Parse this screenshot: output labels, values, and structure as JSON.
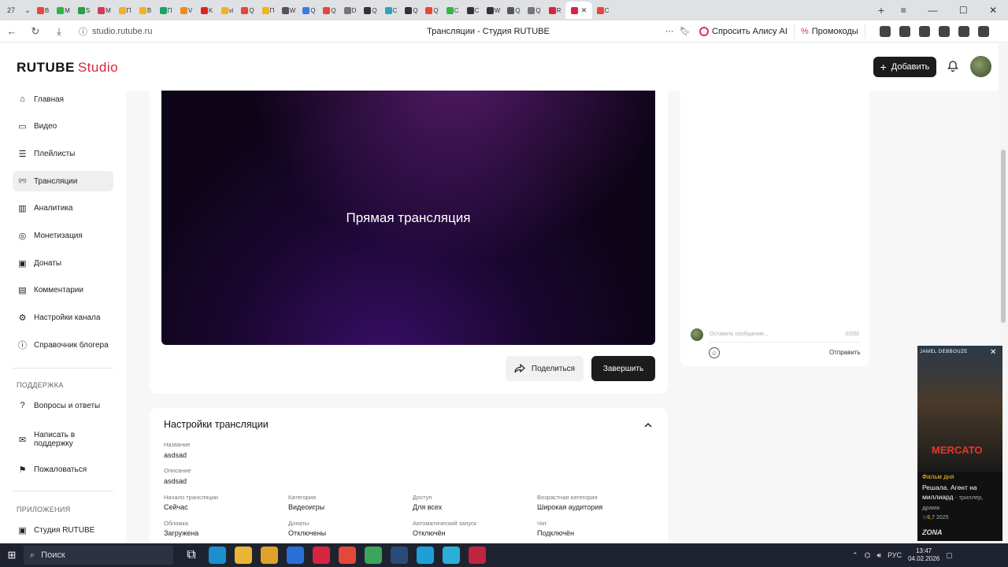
{
  "browser": {
    "tab_counter": "27",
    "tabs": [
      {
        "letter": "В",
        "color": "#e5483b"
      },
      {
        "letter": "М",
        "color": "#2db64a"
      },
      {
        "letter": "S",
        "color": "#25a244"
      },
      {
        "letter": "М",
        "color": "#d63b5a"
      },
      {
        "letter": "П",
        "color": "#f2b31b"
      },
      {
        "letter": "В",
        "color": "#f2b31b"
      },
      {
        "letter": "П",
        "color": "#1da462"
      },
      {
        "letter": "V",
        "color": "#f28b1b"
      },
      {
        "letter": "K",
        "color": "#e02424"
      },
      {
        "letter": "vi",
        "color": "#f2b31b"
      },
      {
        "letter": "Q",
        "color": "#e5483b"
      },
      {
        "letter": "П",
        "color": "#f2b31b"
      },
      {
        "letter": "W",
        "color": "#555555"
      },
      {
        "letter": "Q",
        "color": "#3b7ae5"
      },
      {
        "letter": "Q",
        "color": "#e5483b"
      },
      {
        "letter": "D",
        "color": "#777777"
      },
      {
        "letter": "Q",
        "color": "#333333"
      },
      {
        "letter": "C",
        "color": "#2aa4b8"
      },
      {
        "letter": "Q",
        "color": "#333333"
      },
      {
        "letter": "Q",
        "color": "#e5483b"
      },
      {
        "letter": "C",
        "color": "#2db64a"
      },
      {
        "letter": "C",
        "color": "#333333"
      },
      {
        "letter": "W",
        "color": "#333333"
      },
      {
        "letter": "Q",
        "color": "#555555"
      },
      {
        "letter": "Q",
        "color": "#777777"
      },
      {
        "letter": "R",
        "color": "#d7243f"
      }
    ],
    "active_tab_color": "#d7243f",
    "last_tab": {
      "letter": "C",
      "color": "#e5483b"
    },
    "url": "studio.rutube.ru",
    "page_title": "Трансляции - Студия RUTUBE",
    "ask_alice": "Спросить Алису AI",
    "promocodes": "Промокоды"
  },
  "app": {
    "logo_main": "RUTUBE",
    "logo_studio": "Studio",
    "add_button": "Добавить",
    "accent_color": "#d7243f"
  },
  "sidebar": {
    "items": [
      {
        "label": "Главная",
        "icon": "home-icon"
      },
      {
        "label": "Видео",
        "icon": "video-icon"
      },
      {
        "label": "Плейлисты",
        "icon": "playlist-icon"
      },
      {
        "label": "Трансляции",
        "icon": "broadcast-icon",
        "active": true
      },
      {
        "label": "Аналитика",
        "icon": "analytics-icon"
      },
      {
        "label": "Монетизация",
        "icon": "monetization-icon"
      },
      {
        "label": "Донаты",
        "icon": "donations-icon"
      },
      {
        "label": "Комментарии",
        "icon": "comments-icon"
      },
      {
        "label": "Настройки канала",
        "icon": "gear-icon"
      },
      {
        "label": "Справочник блогера",
        "icon": "info-icon"
      }
    ],
    "support_section": "ПОДДЕРЖКА",
    "support_items": [
      {
        "label": "Вопросы и ответы",
        "icon": "question-icon"
      },
      {
        "label": "Написать в поддержку",
        "icon": "mail-icon"
      },
      {
        "label": "Пожаловаться",
        "icon": "flag-icon"
      }
    ],
    "apps_section": "ПРИЛОЖЕНИЯ",
    "apps_items": [
      {
        "label": "Студия RUTUBE",
        "icon": "studio-app-icon"
      }
    ]
  },
  "player": {
    "title": "Прямая трансляция"
  },
  "actions": {
    "share": "Поделиться",
    "finish": "Завершить"
  },
  "chat": {
    "placeholder": "Оставить сообщение...",
    "counter": "0/200",
    "send": "Отправить"
  },
  "settings": {
    "title": "Настройки трансляции",
    "name_label": "Название",
    "name_value": "asdsad",
    "desc_label": "Описание",
    "desc_value": "asdsad",
    "grid": [
      {
        "label": "Начало трансляции",
        "value": "Сейчас"
      },
      {
        "label": "Категория",
        "value": "Видеоигры"
      },
      {
        "label": "Доступ",
        "value": "Для всех"
      },
      {
        "label": "Возрастная категория",
        "value": "Широкая аудитория"
      },
      {
        "label": "Обложка",
        "value": "Загружена"
      },
      {
        "label": "Донаты",
        "value": "Отключены"
      },
      {
        "label": "Автоматический запуск",
        "value": "Отключён"
      },
      {
        "label": "Чат",
        "value": "Подключён"
      }
    ]
  },
  "promo": {
    "actor": "JAMEL DEBBOUZE",
    "movie": "MERCATO",
    "tag": "Фильм дня",
    "title": "Решала. Агент на миллиард",
    "genre": "- триллер, драма",
    "rating": "6,7",
    "year": "2025",
    "brand": "ZONA"
  },
  "taskbar": {
    "search": "Поиск",
    "lang": "РУС",
    "time": "13:47",
    "date": "04.02.2026"
  }
}
